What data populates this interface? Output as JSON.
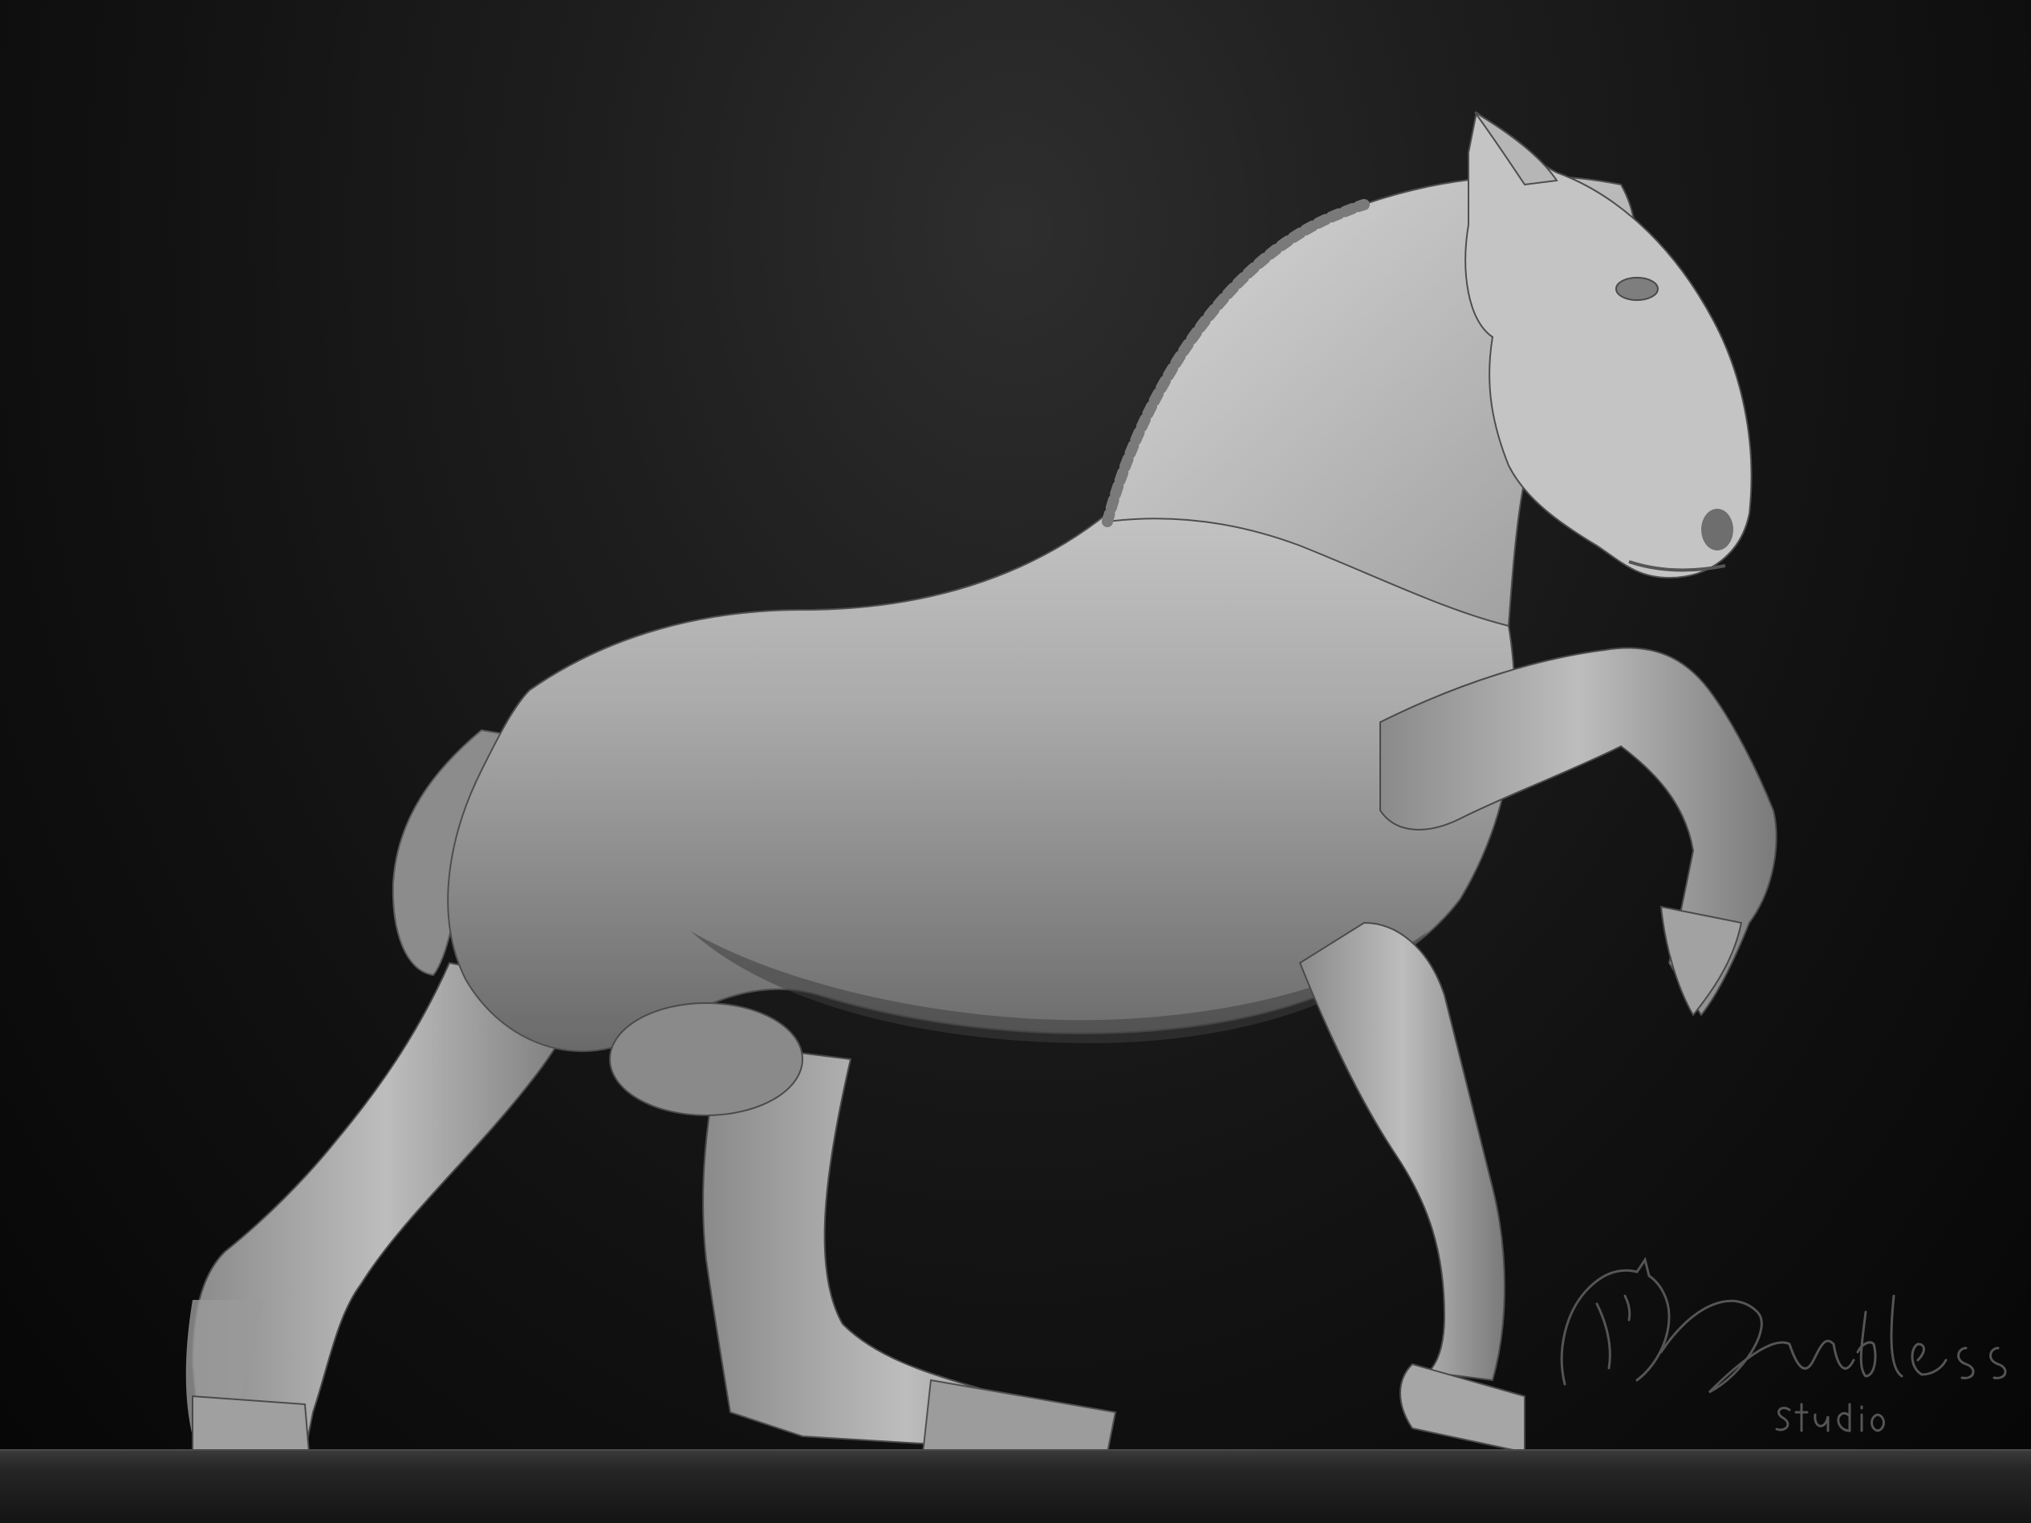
{
  "scene": {
    "subject": "horse-sculpt",
    "colors": {
      "background_top": "#2e2e2e",
      "background_bottom": "#060606",
      "sculpt_light": "#d2d2d2",
      "sculpt_mid": "#a8a8a8",
      "sculpt_shadow": "#5e5e5e",
      "floor": "#2a2a2a"
    }
  },
  "watermark": {
    "brand": "Endless",
    "sub": "Studio"
  }
}
